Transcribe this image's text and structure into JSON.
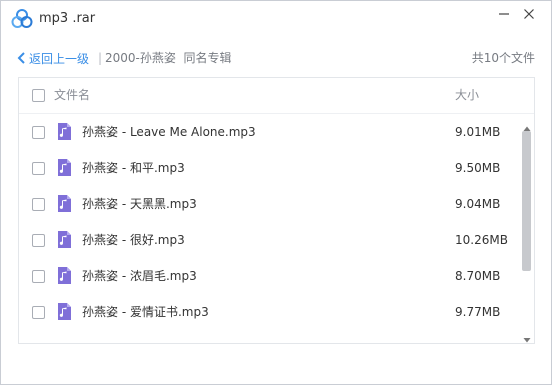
{
  "window": {
    "title": "mp3 .rar",
    "app_icon": "cloud-drive-logo-icon",
    "minimize_icon": "minimize-icon",
    "close_icon": "close-icon"
  },
  "nav": {
    "back_label": "返回上一级",
    "separator": "|",
    "current_folder": "2000-孙燕姿  同名专辑",
    "file_count": "共10个文件"
  },
  "list": {
    "columns": {
      "name": "文件名",
      "size": "大小"
    },
    "files": [
      {
        "name": "孙燕姿 - Leave Me Alone.mp3",
        "size": "9.01MB",
        "icon": "music-file-icon"
      },
      {
        "name": "孙燕姿 - 和平.mp3",
        "size": "9.50MB",
        "icon": "music-file-icon"
      },
      {
        "name": "孙燕姿 - 天黑黑.mp3",
        "size": "9.04MB",
        "icon": "music-file-icon"
      },
      {
        "name": "孙燕姿 - 很好.mp3",
        "size": "10.26MB",
        "icon": "music-file-icon"
      },
      {
        "name": "孙燕姿 - 浓眉毛.mp3",
        "size": "8.70MB",
        "icon": "music-file-icon"
      },
      {
        "name": "孙燕姿 - 爱情证书.mp3",
        "size": "9.77MB",
        "icon": "music-file-icon"
      }
    ]
  },
  "colors": {
    "accent": "#3a8ee6",
    "file_icon": "#7f6fd8",
    "border": "#e3e6ea",
    "scroll_thumb": "#c7c9cd"
  }
}
